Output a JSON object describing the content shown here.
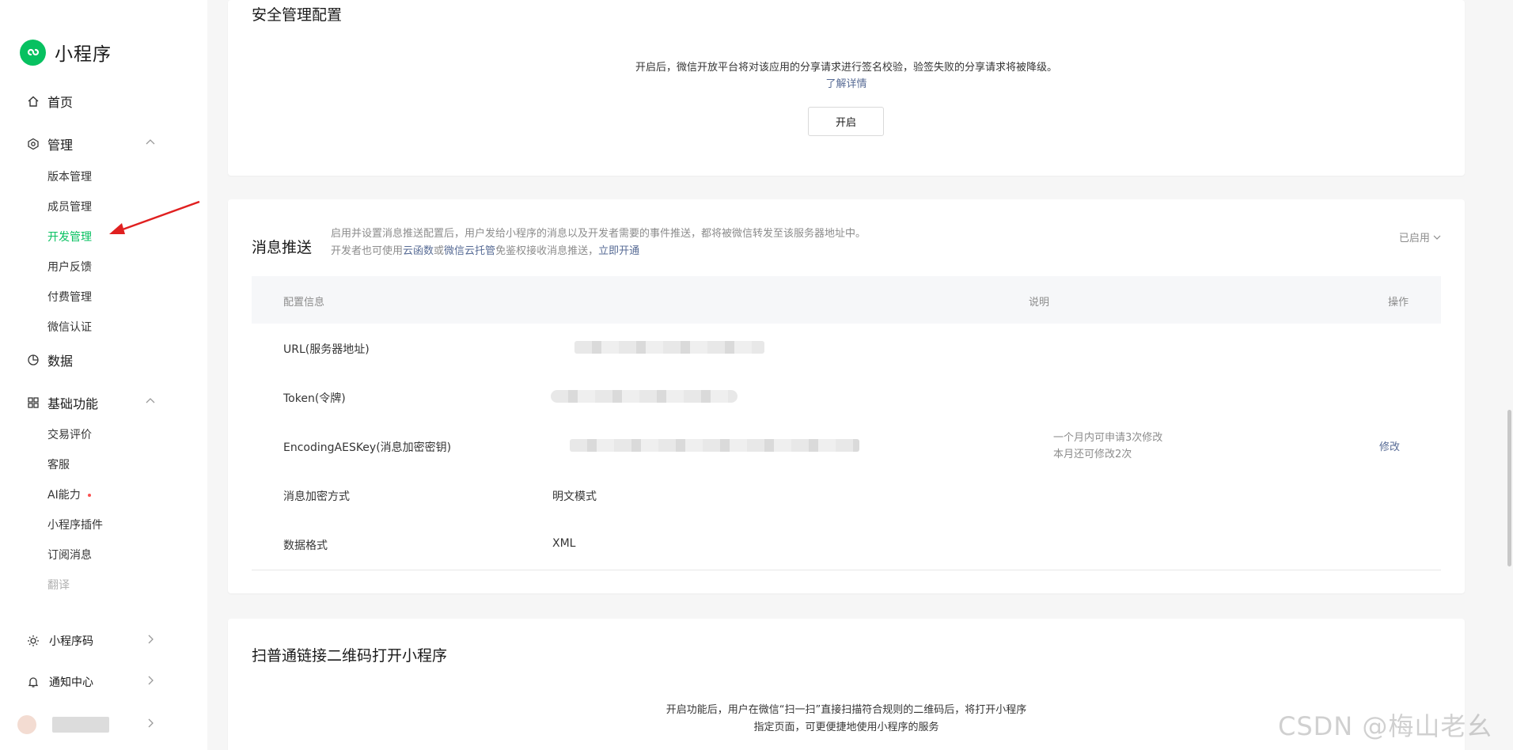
{
  "sidebar": {
    "brand": "小程序",
    "home": "首页",
    "manage": {
      "label": "管理",
      "items": [
        "版本管理",
        "成员管理",
        "开发管理",
        "用户反馈",
        "付费管理",
        "微信认证"
      ]
    },
    "data": "数据",
    "basic": {
      "label": "基础功能",
      "items": [
        "交易评价",
        "客服",
        "AI能力",
        "小程序插件",
        "订阅消息",
        "翻译"
      ]
    },
    "qrcode": "小程序码",
    "notify": "通知中心"
  },
  "security_card": {
    "title": "安全管理配置",
    "description": "开启后，微信开放平台将对该应用的分享请求进行签名校验，验签失败的分享请求将被降级。",
    "link": "了解详情",
    "button": "开启"
  },
  "message_card": {
    "title": "消息推送",
    "desc_line1": "启用并设置消息推送配置后，用户发给小程序的消息以及开发者需要的事件推送，都将被微信转发至该服务器地址中。",
    "desc_line2_prefix": "开发者也可使用",
    "desc_link1": "云函数",
    "desc_or": "或",
    "desc_link2": "微信云托管",
    "desc_mid": "免鉴权接收消息推送，",
    "desc_link3": "立即开通",
    "status": "已启用",
    "table": {
      "headers": [
        "配置信息",
        "说明",
        "操作"
      ],
      "rows": [
        {
          "key": "URL(服务器地址)",
          "value": ""
        },
        {
          "key": "Token(令牌)",
          "value": ""
        },
        {
          "key": "EncodingAESKey(消息加密密钥)",
          "value": "",
          "note1": "一个月内可申请3次修改",
          "note2": "本月还可修改2次",
          "action": "修改"
        },
        {
          "key": "消息加密方式",
          "value": "明文模式"
        },
        {
          "key": "数据格式",
          "value": "XML"
        }
      ]
    }
  },
  "qr_card": {
    "title": "扫普通链接二维码打开小程序",
    "desc_line1": "开启功能后，用户在微信“扫一扫”直接扫描符合规则的二维码后，将打开小程序",
    "desc_line2": "指定页面，可更便捷地使用小程序的服务"
  },
  "watermark": "CSDN @梅山老幺",
  "colors": {
    "accent": "#07c160",
    "link": "#576b95",
    "annotation_arrow": "#e02020"
  }
}
